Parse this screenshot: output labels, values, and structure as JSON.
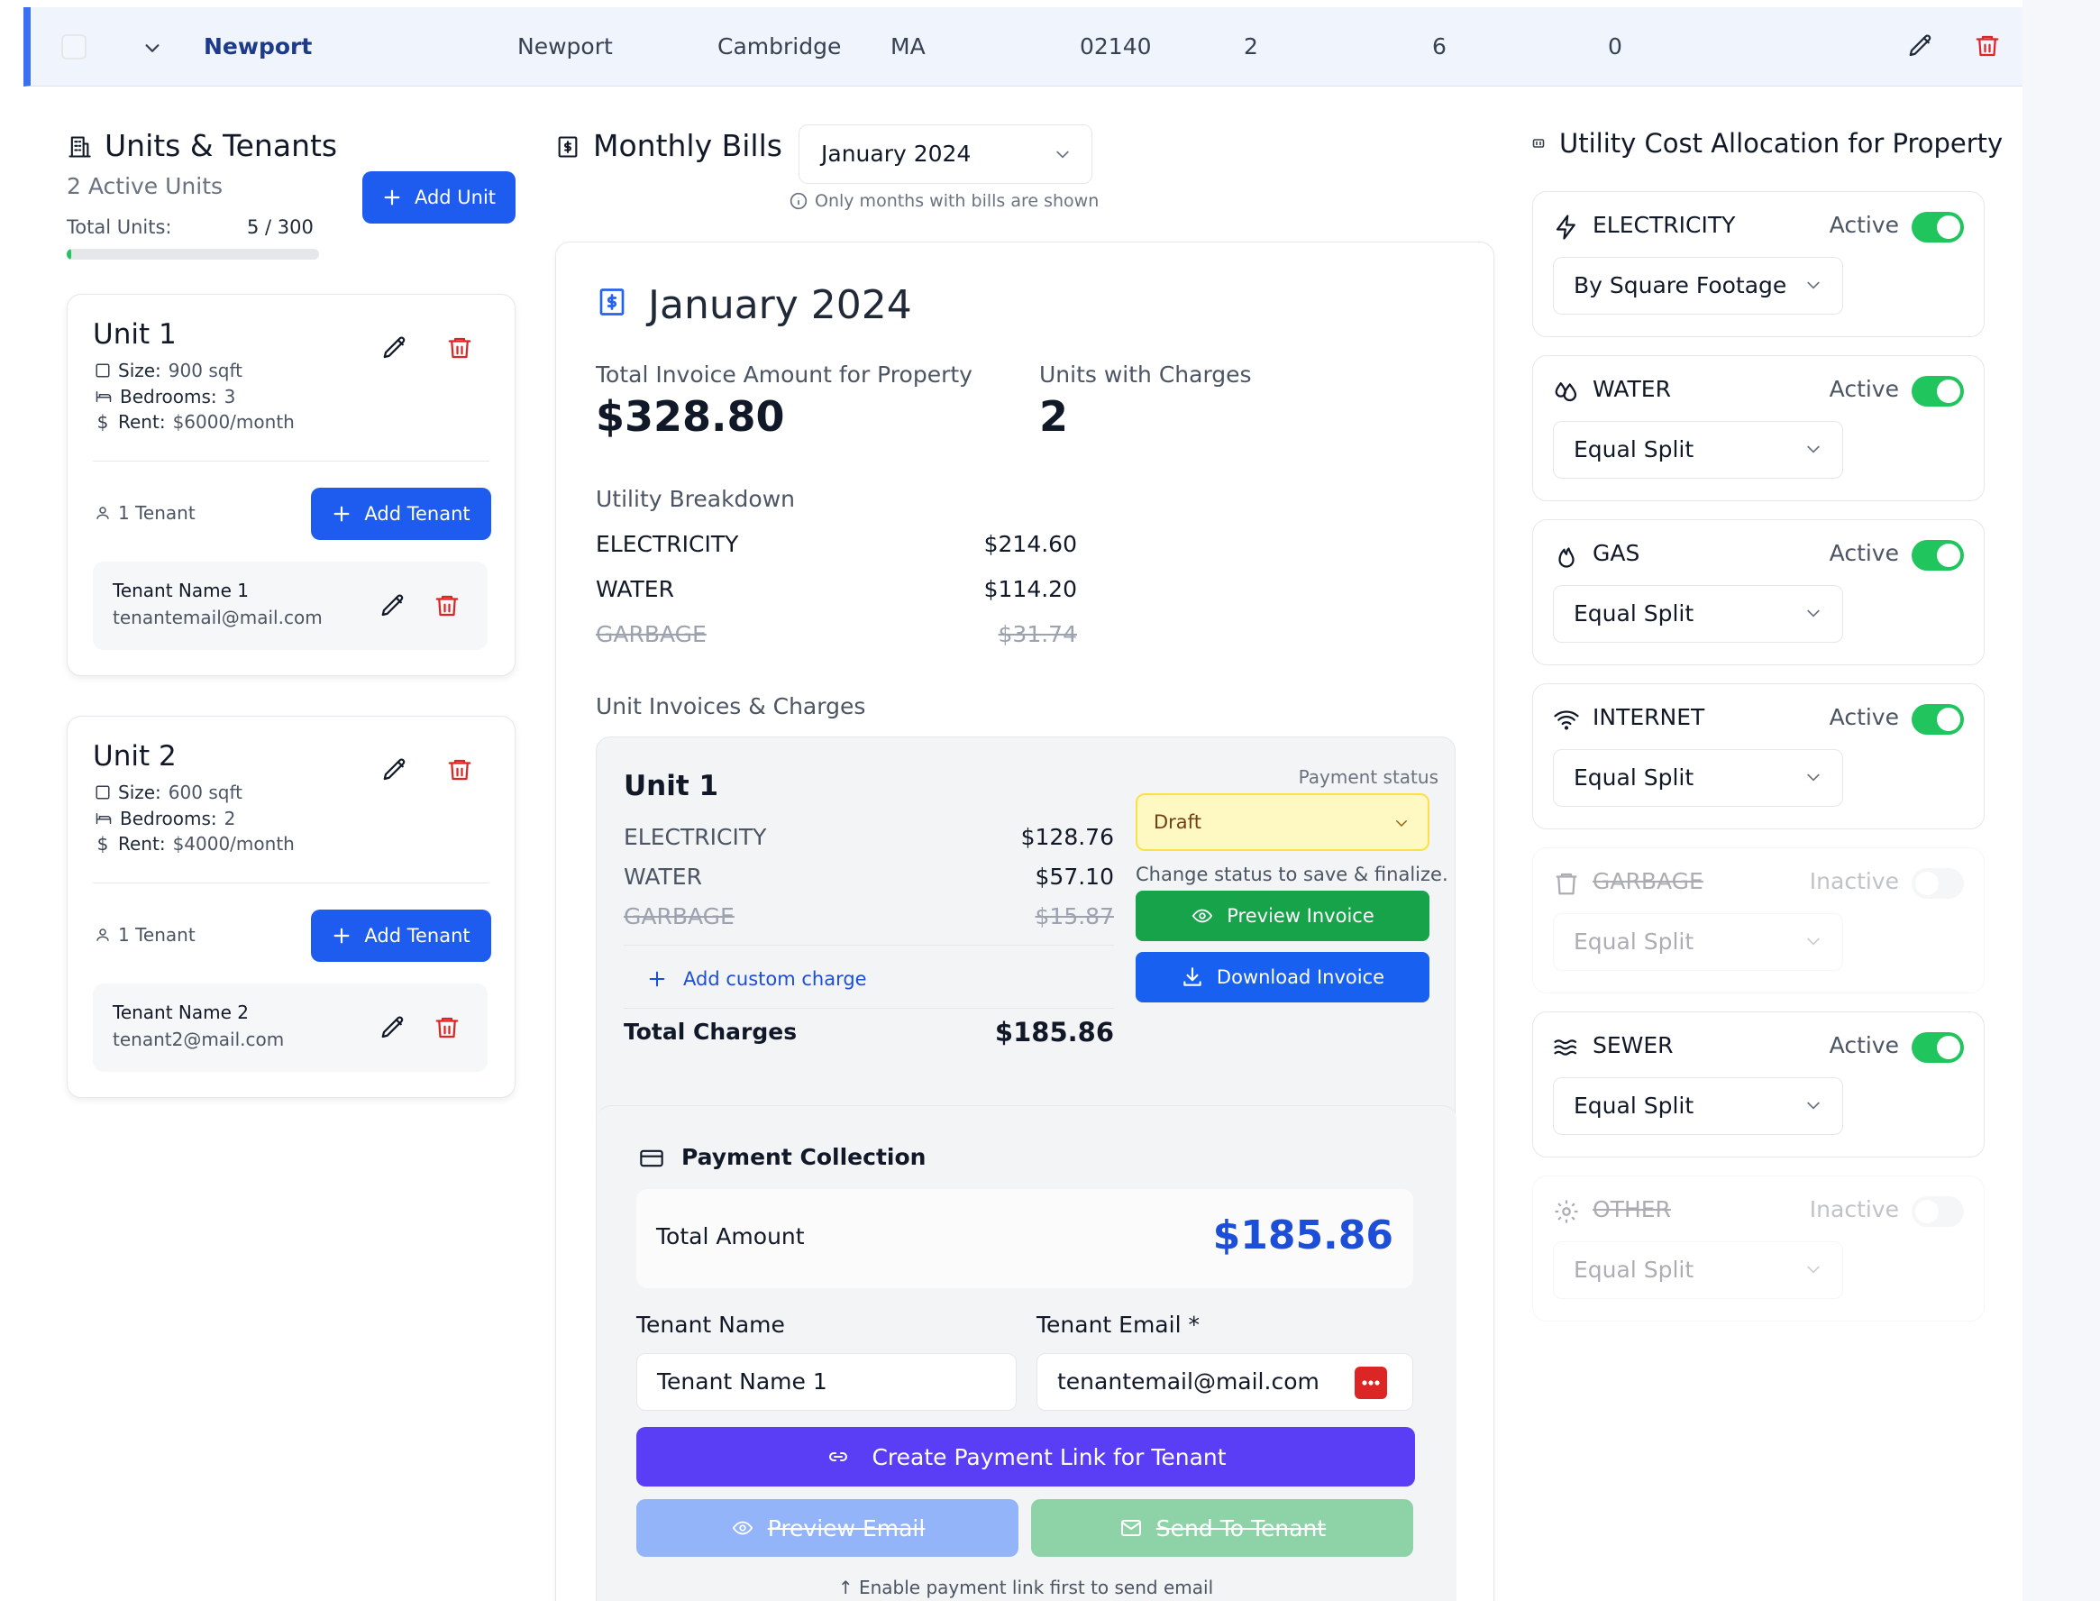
{
  "property_row": {
    "name": "Newport",
    "address": "Newport",
    "city": "Cambridge",
    "state": "MA",
    "zip": "02140",
    "col_a": "2",
    "col_b": "6",
    "col_c": "0"
  },
  "units_panel": {
    "title": "Units & Tenants",
    "subtitle": "2 Active Units",
    "total_units_label": "Total Units:",
    "total_units_value": "5 / 300",
    "total_units_fraction": 0.0167,
    "add_unit_label": "Add Unit",
    "units": [
      {
        "name": "Unit 1",
        "size_label": "Size:",
        "size": "900 sqft",
        "bedrooms_label": "Bedrooms:",
        "bedrooms": "3",
        "rent_label": "Rent:",
        "rent": "$6000/month",
        "tenant_count": "1 Tenant",
        "add_tenant_label": "Add Tenant",
        "tenant_name": "Tenant Name 1",
        "tenant_email": "tenantemail@mail.com"
      },
      {
        "name": "Unit 2",
        "size_label": "Size:",
        "size": "600 sqft",
        "bedrooms_label": "Bedrooms:",
        "bedrooms": "2",
        "rent_label": "Rent:",
        "rent": "$4000/month",
        "tenant_count": "1 Tenant",
        "add_tenant_label": "Add Tenant",
        "tenant_name": "Tenant Name 2",
        "tenant_email": "tenant2@mail.com"
      }
    ]
  },
  "bills": {
    "title": "Monthly Bills",
    "month_select": "January 2024",
    "hint": "Only months with bills are shown",
    "card_title": "January 2024",
    "total_label": "Total Invoice Amount for Property",
    "total_value": "$328.80",
    "units_label": "Units with Charges",
    "units_value": "2",
    "breakdown_title": "Utility Breakdown",
    "breakdown": [
      {
        "name": "ELECTRICITY",
        "amount": "$214.60",
        "inactive": false
      },
      {
        "name": "WATER",
        "amount": "$114.20",
        "inactive": false
      },
      {
        "name": "GARBAGE",
        "amount": "$31.74",
        "inactive": true
      }
    ],
    "invoices_title": "Unit Invoices & Charges",
    "invoice": {
      "unit": "Unit 1",
      "charges": [
        {
          "name": "ELECTRICITY",
          "amount": "$128.76",
          "inactive": false
        },
        {
          "name": "WATER",
          "amount": "$57.10",
          "inactive": false
        },
        {
          "name": "GARBAGE",
          "amount": "$15.87",
          "inactive": true
        }
      ],
      "add_custom": "Add custom charge",
      "total_label": "Total Charges",
      "total_value": "$185.86",
      "payment_status_label": "Payment status",
      "payment_status": "Draft",
      "status_hint": "Change status to save & finalize.",
      "preview_label": "Preview Invoice",
      "download_label": "Download Invoice"
    },
    "payment": {
      "title": "Payment Collection",
      "total_label": "Total Amount",
      "total_value": "$185.86",
      "tenant_name_label": "Tenant Name",
      "tenant_name_value": "Tenant Name 1",
      "tenant_email_label": "Tenant Email *",
      "tenant_email_value": "tenantemail@mail.com",
      "create_link_label": "Create Payment Link for Tenant",
      "preview_email_label": "Preview Email",
      "send_label": "Send To Tenant",
      "footer_hint": "↑ Enable payment link first to send email"
    }
  },
  "allocation": {
    "title": "Utility Cost Allocation for Property",
    "utilities": [
      {
        "name": "ELECTRICITY",
        "icon": "lightning-icon",
        "state": "Active",
        "method": "By Square Footage",
        "active": true
      },
      {
        "name": "WATER",
        "icon": "droplets-icon",
        "state": "Active",
        "method": "Equal Split",
        "active": true
      },
      {
        "name": "GAS",
        "icon": "flame-icon",
        "state": "Active",
        "method": "Equal Split",
        "active": true
      },
      {
        "name": "INTERNET",
        "icon": "wifi-icon",
        "state": "Active",
        "method": "Equal Split",
        "active": true
      },
      {
        "name": "GARBAGE",
        "icon": "trash-icon",
        "state": "Inactive",
        "method": "Equal Split",
        "active": false
      },
      {
        "name": "SEWER",
        "icon": "waves-icon",
        "state": "Active",
        "method": "Equal Split",
        "active": true
      },
      {
        "name": "OTHER",
        "icon": "gear-icon",
        "state": "Inactive",
        "method": "Equal Split",
        "active": false
      }
    ]
  },
  "colors": {
    "primary": "#1e5bef",
    "success": "#16a34a",
    "toggle_on": "#21c55d",
    "danger": "#dc2626",
    "indigo": "#5a3ef5",
    "draft_bg": "#fef9c3"
  }
}
